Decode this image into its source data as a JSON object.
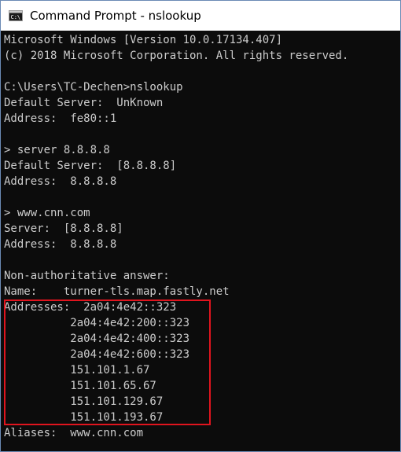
{
  "window": {
    "title": "Command Prompt - nslookup",
    "icon": "cmd-icon"
  },
  "console": {
    "lines": [
      "Microsoft Windows [Version 10.0.17134.407]",
      "(c) 2018 Microsoft Corporation. All rights reserved.",
      "",
      "C:\\Users\\TC-Dechen>nslookup",
      "Default Server:  UnKnown",
      "Address:  fe80::1",
      "",
      "> server 8.8.8.8",
      "Default Server:  [8.8.8.8]",
      "Address:  8.8.8.8",
      "",
      "> www.cnn.com",
      "Server:  [8.8.8.8]",
      "Address:  8.8.8.8",
      "",
      "Non-authoritative answer:",
      "Name:    turner-tls.map.fastly.net",
      "Addresses:  2a04:4e42::323",
      "          2a04:4e42:200::323",
      "          2a04:4e42:400::323",
      "          2a04:4e42:600::323",
      "          151.101.1.67",
      "          151.101.65.67",
      "          151.101.129.67",
      "          151.101.193.67",
      "Aliases:  www.cnn.com"
    ]
  },
  "colors": {
    "console_bg": "#0c0c0c",
    "console_text": "#cccccc",
    "highlight_border": "#e0141e"
  }
}
